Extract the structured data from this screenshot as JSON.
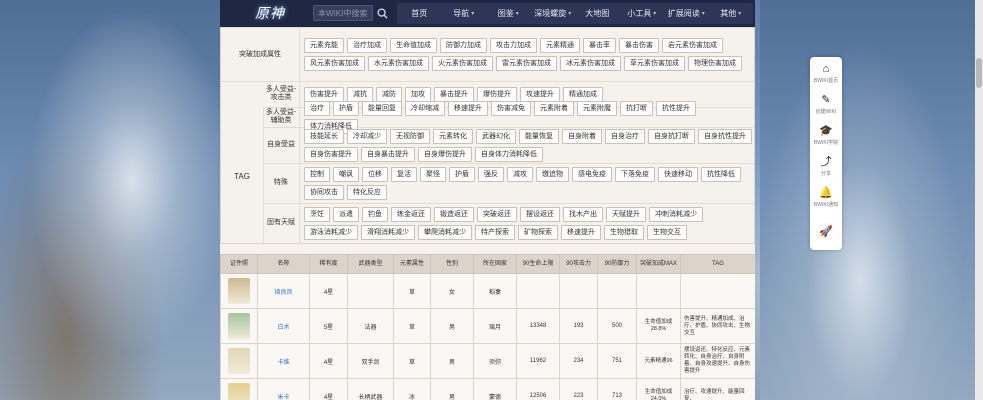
{
  "header": {
    "logo_text": "原神",
    "search_placeholder": "本WIKI中搜索",
    "nav": [
      {
        "label": "首页",
        "caret": false
      },
      {
        "label": "导航",
        "caret": true
      },
      {
        "label": "图鉴",
        "caret": true
      },
      {
        "label": "深境螺旋",
        "caret": true
      },
      {
        "label": "大地图",
        "caret": false
      },
      {
        "label": "小工具",
        "caret": true
      },
      {
        "label": "扩展阅读",
        "caret": true
      },
      {
        "label": "其他",
        "caret": true
      }
    ]
  },
  "filters": {
    "tag_label": "TAG",
    "breakthrough": {
      "label": "突破加成属性",
      "chips": [
        "元素充能",
        "治疗加成",
        "生命值加成",
        "防御力加成",
        "攻击力加成",
        "元素精通",
        "暴击率",
        "暴击伤害",
        "岩元素伤害加成",
        "风元素伤害加成",
        "水元素伤害加成",
        "火元素伤害加成",
        "雷元素伤害加成",
        "冰元素伤害加成",
        "草元素伤害加成",
        "物理伤害加成"
      ]
    },
    "multi_attack": {
      "label": "多人受益-攻击类",
      "chips": [
        "伤害提升",
        "减抗",
        "减防",
        "加攻",
        "暴击提升",
        "爆伤提升",
        "攻速提升",
        "精通加成"
      ]
    },
    "multi_support": {
      "label": "多人受益-辅助类",
      "chips": [
        "治疗",
        "护盾",
        "能量回复",
        "冷却缩减",
        "移速提升",
        "伤害减免",
        "元素附着",
        "元素附魔",
        "抗打断",
        "抗性提升",
        "体力消耗降低"
      ]
    },
    "self_buff": {
      "label": "自身受益",
      "chips": [
        "技能延长",
        "冷却减少",
        "无视防御",
        "元素转化",
        "武器幻化",
        "能量恢复",
        "自身附着",
        "自身治疗",
        "自身抗打断",
        "自身抗性提升",
        "自身伤害提升",
        "自身暴击提升",
        "自身爆伤提升",
        "自身体力消耗降低"
      ]
    },
    "special": {
      "label": "特殊",
      "chips": [
        "控制",
        "嘲讽",
        "位移",
        "复活",
        "聚怪",
        "护盾",
        "强反",
        "减攻",
        "缴追物",
        "感电免疫",
        "下落免疫",
        "快速移动",
        "抗性降低",
        "协同攻击",
        "特化反应"
      ]
    },
    "talent": {
      "label": "固有天赋",
      "chips": [
        "烹饪",
        "派遣",
        "钓鱼",
        "练金返还",
        "锻造返还",
        "突破返还",
        "摆设返还",
        "找木产出",
        "天赋提升",
        "冲刺消耗减少",
        "游泳消耗减少",
        "滑翔消耗减少",
        "攀爬消耗减少",
        "特产探索",
        "矿物探索",
        "移速提升",
        "生物猎取",
        "生物交互"
      ]
    }
  },
  "table": {
    "headers": [
      "证件照",
      "名称",
      "稀有度",
      "武器类型",
      "元素属性",
      "性别",
      "所在国家",
      "90生命上限",
      "90攻击力",
      "90防御力",
      "突破加成MAX",
      "TAG"
    ],
    "rows": [
      {
        "name": "绮良良",
        "rarity": "4星",
        "weapon": "",
        "element": "草",
        "gender": "女",
        "nation": "稻妻",
        "hp": "",
        "atk": "",
        "def": "",
        "bonus": "",
        "tag": "",
        "avatar": "#cdb98f"
      },
      {
        "name": "白术",
        "rarity": "5星",
        "weapon": "法器",
        "element": "草",
        "gender": "男",
        "nation": "璃月",
        "hp": "13348",
        "atk": "193",
        "def": "500",
        "bonus": "生命值加成28.8%",
        "tag": "伤害提升、精通加成、治疗、护盾、协同攻击、生物交互",
        "avatar": "#a6c6a0"
      },
      {
        "name": "卡维",
        "rarity": "4星",
        "weapon": "双手剑",
        "element": "草",
        "gender": "男",
        "nation": "须弥",
        "hp": "11962",
        "atk": "234",
        "def": "751",
        "bonus": "元素精通96",
        "tag": "摆设返还、特化反应、元素转化、自身治疗、自身附着、自身攻速提升、自身伤害提升",
        "avatar": "#e3d6b8"
      },
      {
        "name": "米卡",
        "rarity": "4星",
        "weapon": "长柄武器",
        "element": "冰",
        "gender": "男",
        "nation": "蒙德",
        "hp": "12506",
        "atk": "223",
        "def": "713",
        "bonus": "生命值加成24.0%",
        "tag": "治疗、攻速提升、能量回复、",
        "avatar": "#e6cf8a"
      }
    ]
  },
  "sidebar": [
    {
      "icon": "⌂",
      "label": "BWIKI首页"
    },
    {
      "icon": "✎",
      "label": "创建WIKI"
    },
    {
      "icon": "🎓",
      "label": "BWIKI学院"
    },
    {
      "icon": "⤴",
      "label": "分享"
    },
    {
      "icon": "🔔",
      "label": "BWIKI通知"
    },
    {
      "icon": "🚀",
      "label": ""
    }
  ]
}
